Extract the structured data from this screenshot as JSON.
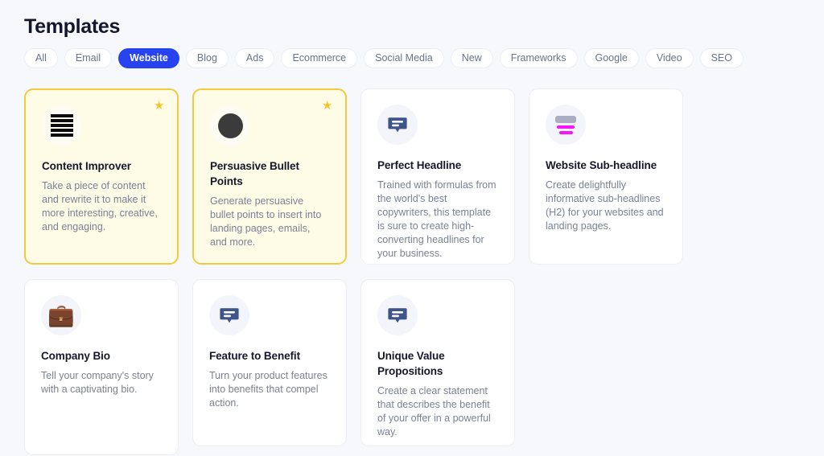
{
  "header": {
    "title": "Templates"
  },
  "filters": {
    "active": "Website",
    "chips": [
      {
        "label": "All",
        "active": false
      },
      {
        "label": "Email",
        "active": false
      },
      {
        "label": "Website",
        "active": true
      },
      {
        "label": "Blog",
        "active": false
      },
      {
        "label": "Ads",
        "active": false
      },
      {
        "label": "Ecommerce",
        "active": false
      },
      {
        "label": "Social Media",
        "active": false
      },
      {
        "label": "New",
        "active": false
      },
      {
        "label": "Frameworks",
        "active": false
      },
      {
        "label": "Google",
        "active": false
      },
      {
        "label": "Video",
        "active": false
      },
      {
        "label": "SEO",
        "active": false
      }
    ]
  },
  "colors": {
    "page_background": "#F7F8FC",
    "accent_blue": "#2743F0",
    "favorite_border": "#F3CA3E",
    "favorite_background": "#FEFBE6",
    "star": "#F6C42A",
    "bubble_navy": "#3F5488",
    "headline_magenta": "#F716F7",
    "headline_gray": "#A9AFC0"
  },
  "cards": [
    {
      "title": "Content Improver",
      "description": "Take a piece of content and rewrite it to make it more interesting, creative, and engaging.",
      "icon": "content-lines-icon",
      "favorite": true,
      "star_label": "★"
    },
    {
      "title": "Persuasive Bullet Points",
      "description": "Generate persuasive bullet points to insert into landing pages, emails, and more.",
      "icon": "solid-circle-icon",
      "favorite": true,
      "star_label": "★"
    },
    {
      "title": "Perfect Headline",
      "description": "Trained with formulas from the world's best copywriters, this template is sure to create high-converting headlines for your business.",
      "icon": "speech-bubble-icon",
      "favorite": false,
      "star_label": ""
    },
    {
      "title": "Website Sub-headline",
      "description": "Create delightfully informative sub-headlines (H2) for your websites and landing pages.",
      "icon": "headline-bars-icon",
      "favorite": false,
      "star_label": ""
    },
    {
      "title": "Company Bio",
      "description": "Tell your company's story with a captivating bio.",
      "icon": "briefcase-icon",
      "icon_glyph": "💼",
      "favorite": false,
      "star_label": ""
    },
    {
      "title": "Feature to Benefit",
      "description": "Turn your product features into benefits that compel action.",
      "icon": "speech-bubble-icon",
      "favorite": false,
      "star_label": ""
    },
    {
      "title": "Unique Value Propositions",
      "description": "Create a clear statement that describes the benefit of your offer in a powerful way.",
      "icon": "speech-bubble-icon",
      "favorite": false,
      "star_label": ""
    }
  ]
}
